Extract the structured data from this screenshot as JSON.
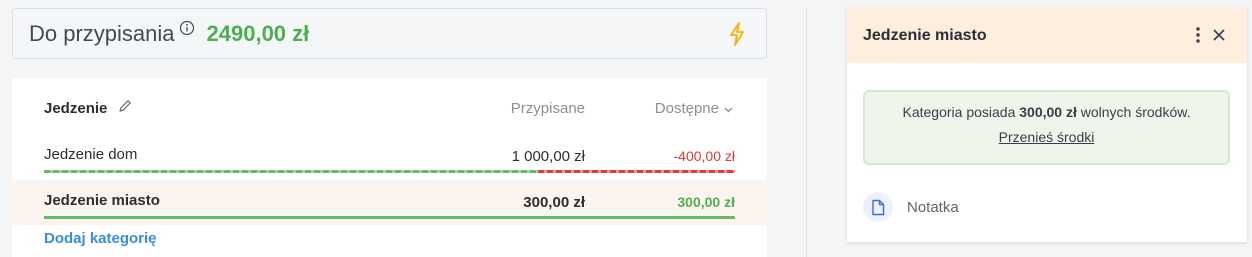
{
  "summary": {
    "label": "Do przypisania",
    "amount": "2490,00 zł",
    "info_icon": "info-circle-icon",
    "action_icon": "lightning-bolt-icon"
  },
  "table": {
    "group_name": "Jedzenie",
    "edit_icon": "pencil-icon",
    "col_assigned": "Przypisane",
    "col_available": "Dostępne",
    "sort_icon": "chevron-down-icon",
    "rows": [
      {
        "name": "Jedzenie dom",
        "assigned": "1 000,00 zł",
        "available": "-400,00 zł",
        "spent_fraction": 1.4
      },
      {
        "name": "Jedzenie miasto",
        "assigned": "300,00 zł",
        "available": "300,00 zł",
        "spent_fraction": 0.0
      }
    ],
    "add_category": "Dodaj kategorię"
  },
  "panel": {
    "title": "Jedzenie miasto",
    "notice_prefix": "Kategoria posiada",
    "notice_amount": "300,00 zł",
    "notice_suffix": "wolnych środków.",
    "transfer_link": "Przenieś środki",
    "note_label": "Notatka"
  },
  "colors": {
    "positive": "#4caf50",
    "negative": "#e53935",
    "link": "#3a8edb",
    "panel_header": "#fdeede",
    "selected_row": "#fcf5ef"
  }
}
